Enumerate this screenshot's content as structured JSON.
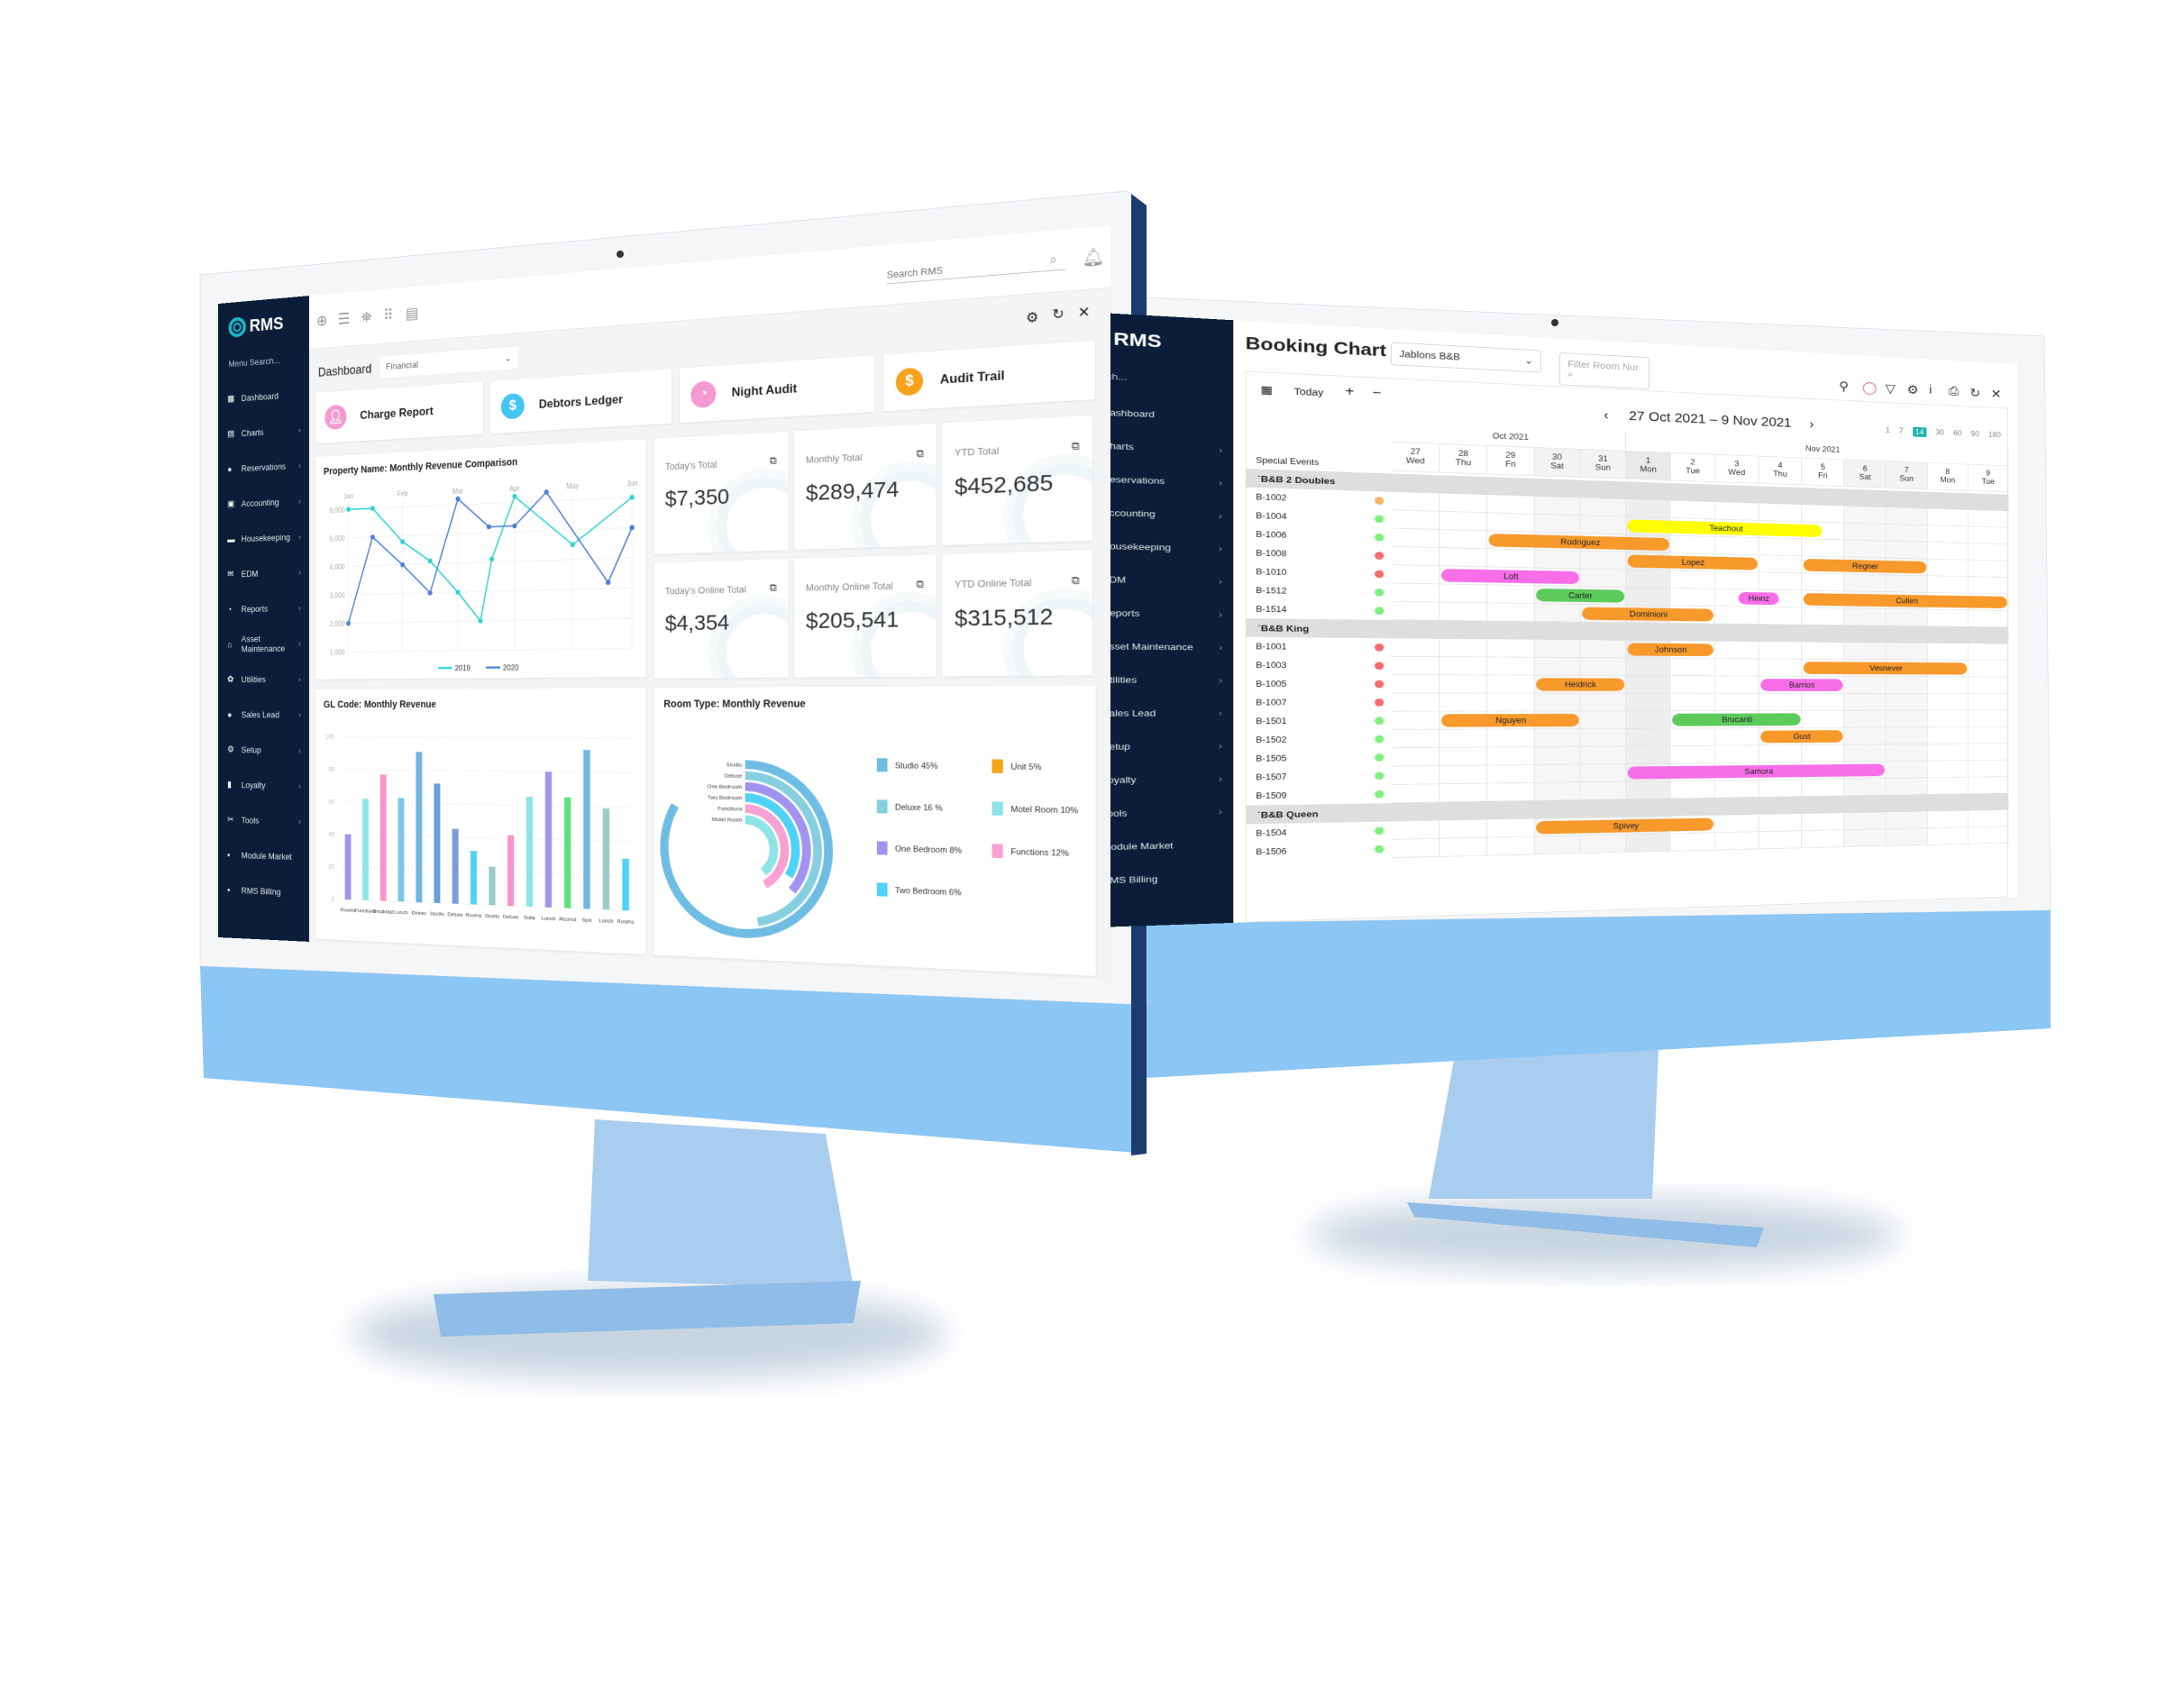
{
  "left_screen": {
    "logo": "RMS",
    "menu_search": "Menu Search...",
    "sidebar": [
      {
        "icon": "dashboard-icon",
        "label": "Dashboard",
        "chevron": false
      },
      {
        "icon": "charts-icon",
        "label": "Charts",
        "chevron": true
      },
      {
        "icon": "reservations-icon",
        "label": "Reservations",
        "chevron": true
      },
      {
        "icon": "accounting-icon",
        "label": "Accounting",
        "chevron": true
      },
      {
        "icon": "housekeeping-icon",
        "label": "Housekeeping",
        "chevron": true
      },
      {
        "icon": "edm-icon",
        "label": "EDM",
        "chevron": true
      },
      {
        "icon": "reports-icon",
        "label": "Reports",
        "chevron": true
      },
      {
        "icon": "asset-maintenance-icon",
        "label": "Asset Maintenance",
        "chevron": true
      },
      {
        "icon": "utilities-icon",
        "label": "Utilities",
        "chevron": true
      },
      {
        "icon": "sales-lead-icon",
        "label": "Sales Lead",
        "chevron": true
      },
      {
        "icon": "setup-icon",
        "label": "Setup",
        "chevron": true
      },
      {
        "icon": "loyalty-icon",
        "label": "Loyalty",
        "chevron": true
      },
      {
        "icon": "tools-icon",
        "label": "Tools",
        "chevron": true
      },
      {
        "icon": "module-market-icon",
        "label": "Module Market",
        "chevron": false
      },
      {
        "icon": "rms-billing-icon",
        "label": "RMS Billing",
        "chevron": false
      }
    ],
    "search_placeholder": "Search RMS",
    "page_title": "Dashboard",
    "dashboard_select": "Financial",
    "quick_links": [
      {
        "label": "Charge Report",
        "icon": "user-icon",
        "color": "#f59ad0"
      },
      {
        "label": "Debtors Ledger",
        "icon": "dollar-icon",
        "color": "#45c4f0"
      },
      {
        "label": "Night Audit",
        "icon": "clock-icon",
        "color": "#f59ad0"
      },
      {
        "label": "Audit Trail",
        "icon": "dollar-icon",
        "color": "#f5a21f"
      }
    ],
    "kpis": [
      {
        "label": "Today's Total",
        "value": "$7,350"
      },
      {
        "label": "Monthly Total",
        "value": "$289,474"
      },
      {
        "label": "YTD Total",
        "value": "$452,685"
      },
      {
        "label": "Today's Online Total",
        "value": "$4,354"
      },
      {
        "label": "Monthly Online Total",
        "value": "$205,541"
      },
      {
        "label": "YTD Online Total",
        "value": "$315,512"
      }
    ]
  },
  "chart_data": [
    {
      "type": "line",
      "title": "Property Name: Monthly Revenue Comparison",
      "x_ticks": [
        "Jan",
        "Feb",
        "Mar",
        "Apr",
        "May",
        "Jun"
      ],
      "ylim": [
        1000,
        6000
      ],
      "y_ticks": [
        "1,000",
        "2,000",
        "3,000",
        "4,000",
        "5,000",
        "6,000"
      ],
      "legend": "bottom",
      "grid": true,
      "series": [
        {
          "name": "2019",
          "color": "#2fd3d3",
          "points": [
            [
              0,
              6000
            ],
            [
              0.45,
              6000
            ],
            [
              1,
              4800
            ],
            [
              1.5,
              4100
            ],
            [
              2,
              3000
            ],
            [
              2.4,
              2000
            ],
            [
              2.6,
              4100
            ],
            [
              3,
              6200
            ],
            [
              4,
              4500
            ],
            [
              5,
              6000
            ]
          ]
        },
        {
          "name": "2020",
          "color": "#4a7fd4",
          "points": [
            [
              0,
              2000
            ],
            [
              0.45,
              5000
            ],
            [
              1,
              4000
            ],
            [
              1.5,
              3000
            ],
            [
              2,
              6200
            ],
            [
              2.55,
              5200
            ],
            [
              3,
              5200
            ],
            [
              3.55,
              6300
            ],
            [
              4.6,
              3200
            ],
            [
              5,
              5000
            ]
          ]
        }
      ]
    },
    {
      "type": "bar",
      "title": "GL Code: Monthly Revenue",
      "ylim": [
        0,
        100
      ],
      "y_ticks": [
        "0",
        "20",
        "40",
        "60",
        "80",
        "100"
      ],
      "grid": true,
      "categories": [
        "Rooms",
        "Functions",
        "Breakfast",
        "Lunch",
        "Dinner",
        "Studio",
        "Deluxe",
        "Rooms",
        "Studio",
        "Deluxe",
        "Suite",
        "Lunch",
        "Alcohol",
        "Spa",
        "Lunch",
        "Rooms"
      ],
      "values": [
        40,
        62,
        77,
        63,
        91,
        72,
        45,
        32,
        23,
        42,
        65,
        80,
        65,
        93,
        59,
        30
      ],
      "colors": [
        "#a393f0",
        "#8ee3e6",
        "#f794c8",
        "#7cc7e6",
        "#6fb7e0",
        "#6a9fdc",
        "#7a9ed8",
        "#4fd2f7",
        "#9cc9cc",
        "#f794c8",
        "#8ee3e6",
        "#a393f0",
        "#5fe07a",
        "#6fb7e0",
        "#9cc9cc",
        "#4fd2f7"
      ]
    },
    {
      "type": "pie",
      "title": "Room Type: Monthly Revenue",
      "legend": "right",
      "slices": [
        {
          "name": "Studio",
          "legend": "Studio 45%",
          "value": 45,
          "color": "#6fbde3"
        },
        {
          "name": "Deluxe",
          "legend": "Deluxe 16 %",
          "value": 16,
          "color": "#86cfe0"
        },
        {
          "name": "One Bedroom",
          "legend": "One Bedroom 8%",
          "value": 8,
          "color": "#a393f0"
        },
        {
          "name": "Two Bedroom",
          "legend": "Two Bedroom 6%",
          "value": 6,
          "color": "#4fd2f7"
        },
        {
          "name": "Functions",
          "legend": "Functions 12%",
          "value": 12,
          "color": "#f7a1d2"
        },
        {
          "name": "Motel Room",
          "legend": "Motel Room 10%",
          "value": 10,
          "color": "#8ee3e6"
        },
        {
          "name": "Unit",
          "legend": "Unit 5%",
          "value": 5,
          "color": "#f7a21b"
        }
      ]
    }
  ],
  "right_screen": {
    "logo": "RMS",
    "menu_search": "Search...",
    "sidebar": [
      "Dashboard",
      "Charts",
      "Reservations",
      "Accounting",
      "Housekeeping",
      "EDM",
      "Reports",
      "Asset Maintenance",
      "Utilities",
      "Sales Lead",
      "Setup",
      "Loyalty",
      "Tools",
      "Module Market",
      "RMS Billing"
    ],
    "title": "Booking Chart",
    "property": "Jablons B&B",
    "filter_placeholder": "Filter Room Nur",
    "today": "Today",
    "plus": "+",
    "minus": "−",
    "range": "27 Oct 2021 – 9 Nov 2021",
    "spans": [
      "1",
      "7",
      "14",
      "30",
      "60",
      "90",
      "180"
    ],
    "active_span": "14",
    "accent": "#17b3ad",
    "months": [
      {
        "label": "Oct 2021",
        "days": 5
      },
      {
        "label": "Nov 2021",
        "days": 9
      }
    ],
    "days": [
      [
        "27",
        "Wed"
      ],
      [
        "28",
        "Thu"
      ],
      [
        "29",
        "Fri"
      ],
      [
        "30",
        "Sat"
      ],
      [
        "31",
        "Sun"
      ],
      [
        "1",
        "Mon"
      ],
      [
        "2",
        "Tue"
      ],
      [
        "3",
        "Wed"
      ],
      [
        "4",
        "Thu"
      ],
      [
        "5",
        "Fri"
      ],
      [
        "6",
        "Sat"
      ],
      [
        "7",
        "Sun"
      ],
      [
        "8",
        "Mon"
      ],
      [
        "9",
        "Tue"
      ]
    ],
    "special_events": "Special Events",
    "status_colors": {
      "orange": "#f7b26b",
      "green": "#7ef07e",
      "red": "#f56b6b"
    },
    "booking_colors": {
      "orange": "#f7992b",
      "yellow": "#ffff00",
      "pink": "#f76ee8",
      "green": "#5ccb5c"
    },
    "groups": [
      {
        "name": "B&B 2 Doubles",
        "rooms": [
          {
            "room": "B-1002",
            "status": "orange",
            "bookings": []
          },
          {
            "room": "B-1004",
            "status": "green",
            "bookings": [
              {
                "guest": "Teachout",
                "start": 5,
                "nights": 4.5,
                "color": "yellow"
              }
            ]
          },
          {
            "room": "B-1006",
            "status": "green",
            "bookings": [
              {
                "guest": "Rodriguez",
                "start": 2,
                "nights": 4,
                "color": "orange"
              }
            ]
          },
          {
            "room": "B-1008",
            "status": "red",
            "bookings": [
              {
                "guest": "Lopez",
                "start": 5,
                "nights": 3,
                "color": "orange"
              },
              {
                "guest": "Regner",
                "start": 9,
                "nights": 3,
                "color": "orange"
              }
            ]
          },
          {
            "room": "B-1010",
            "status": "red",
            "bookings": [
              {
                "guest": "Loft",
                "start": 1,
                "nights": 3,
                "color": "pink"
              }
            ]
          },
          {
            "room": "B-1512",
            "status": "green",
            "bookings": [
              {
                "guest": "Carter",
                "start": 3,
                "nights": 2,
                "color": "green"
              },
              {
                "guest": "Heinz",
                "start": 7.5,
                "nights": 1,
                "color": "pink"
              },
              {
                "guest": "Cullen",
                "start": 9,
                "nights": 5,
                "color": "orange"
              }
            ]
          },
          {
            "room": "B-1514",
            "status": "green",
            "bookings": [
              {
                "guest": "Dominioni",
                "start": 4,
                "nights": 3,
                "color": "orange"
              }
            ]
          }
        ]
      },
      {
        "name": "B&B King",
        "rooms": [
          {
            "room": "B-1001",
            "status": "red",
            "bookings": [
              {
                "guest": "Johnson",
                "start": 5,
                "nights": 2,
                "color": "orange"
              }
            ]
          },
          {
            "room": "B-1003",
            "status": "red",
            "bookings": [
              {
                "guest": "Vesnever",
                "start": 9,
                "nights": 4,
                "color": "orange"
              }
            ]
          },
          {
            "room": "B-1005",
            "status": "red",
            "bookings": [
              {
                "guest": "Heidrick",
                "start": 3,
                "nights": 2,
                "color": "orange"
              },
              {
                "guest": "Barrios",
                "start": 8,
                "nights": 2,
                "color": "pink"
              }
            ]
          },
          {
            "room": "B-1007",
            "status": "red",
            "bookings": []
          },
          {
            "room": "B-1501",
            "status": "green",
            "bookings": [
              {
                "guest": "Nguyen",
                "start": 1,
                "nights": 3,
                "color": "orange"
              },
              {
                "guest": "Brucanti",
                "start": 6,
                "nights": 3,
                "color": "green"
              }
            ]
          },
          {
            "room": "B-1502",
            "status": "green",
            "bookings": [
              {
                "guest": "Gust",
                "start": 8,
                "nights": 2,
                "color": "orange"
              }
            ]
          },
          {
            "room": "B-1505",
            "status": "green",
            "bookings": []
          },
          {
            "room": "B-1507",
            "status": "green",
            "bookings": [
              {
                "guest": "Samora",
                "start": 5,
                "nights": 6,
                "color": "pink"
              }
            ]
          },
          {
            "room": "B-1509",
            "status": "green",
            "bookings": []
          }
        ]
      },
      {
        "name": "B&B Queen",
        "rooms": [
          {
            "room": "B-1504",
            "status": "green",
            "bookings": [
              {
                "guest": "Spivey",
                "start": 3,
                "nights": 4,
                "color": "orange"
              }
            ]
          },
          {
            "room": "B-1506",
            "status": "green",
            "bookings": []
          }
        ]
      }
    ]
  }
}
